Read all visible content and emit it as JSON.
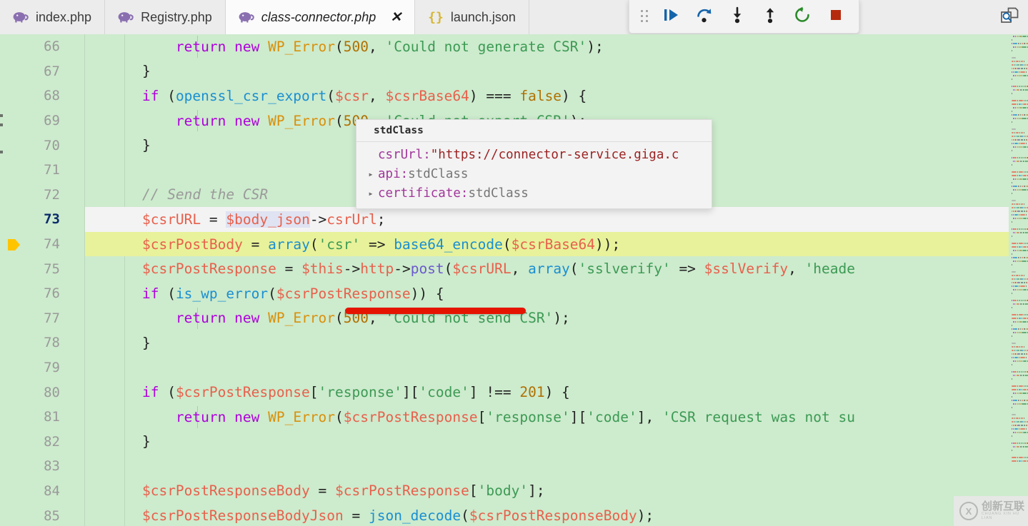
{
  "window": {
    "title": "class-connector.php"
  },
  "tabs": [
    {
      "label": "index.php",
      "icon": "php-elephant-icon",
      "active": false,
      "closable": false
    },
    {
      "label": "Registry.php",
      "icon": "php-elephant-icon",
      "active": false,
      "closable": false
    },
    {
      "label": "class-connector.php",
      "icon": "php-elephant-icon",
      "active": true,
      "closable": true,
      "close_label": "✕"
    },
    {
      "label": "launch.json",
      "icon": "json-braces-icon",
      "icon_text": "{}",
      "active": false,
      "closable": false
    }
  ],
  "debug_toolbar": {
    "handle": "drag-handle-icon",
    "buttons": [
      {
        "name": "continue-button",
        "label": "Continue",
        "icon": "continue-icon",
        "color": "#1464aa"
      },
      {
        "name": "step-over-button",
        "label": "Step Over",
        "icon": "step-over-icon",
        "color": "#1464aa"
      },
      {
        "name": "step-into-button",
        "label": "Step Into",
        "icon": "step-into-icon",
        "color": "#1e1e1e"
      },
      {
        "name": "step-out-button",
        "label": "Step Out",
        "icon": "step-out-icon",
        "color": "#1e1e1e"
      },
      {
        "name": "restart-button",
        "label": "Restart",
        "icon": "restart-icon",
        "color": "#2a8a2a"
      },
      {
        "name": "stop-button",
        "label": "Stop",
        "icon": "stop-icon",
        "color": "#b52a0e"
      }
    ]
  },
  "editor_actions": [
    {
      "name": "open-preview-button",
      "label": "Open Preview to the Side",
      "icon": "preview-search-icon"
    }
  ],
  "editor": {
    "current_line": 73,
    "execution_line": 74,
    "background": "#cdebcd",
    "current_line_highlight": "#f3f3f3",
    "execution_line_highlight": "#e8f29a",
    "lines": [
      {
        "number": 66,
        "tokens": [
          {
            "t": "        ",
            "c": "t-op"
          },
          {
            "t": "return",
            "c": "t-kw"
          },
          {
            "t": " ",
            "c": "t-op"
          },
          {
            "t": "new",
            "c": "t-kw"
          },
          {
            "t": " ",
            "c": "t-op"
          },
          {
            "t": "WP_Error",
            "c": "t-cls"
          },
          {
            "t": "(",
            "c": "t-punct"
          },
          {
            "t": "500",
            "c": "t-num"
          },
          {
            "t": ", ",
            "c": "t-punct"
          },
          {
            "t": "'Could not generate CSR'",
            "c": "t-str"
          },
          {
            "t": ");",
            "c": "t-punct"
          }
        ]
      },
      {
        "number": 67,
        "tokens": [
          {
            "t": "    ",
            "c": "t-op"
          },
          {
            "t": "}",
            "c": "t-punct"
          }
        ]
      },
      {
        "number": 68,
        "tokens": [
          {
            "t": "    ",
            "c": "t-op"
          },
          {
            "t": "if",
            "c": "t-kw"
          },
          {
            "t": " (",
            "c": "t-punct"
          },
          {
            "t": "openssl_csr_export",
            "c": "t-fn"
          },
          {
            "t": "(",
            "c": "t-punct"
          },
          {
            "t": "$csr",
            "c": "t-var"
          },
          {
            "t": ", ",
            "c": "t-punct"
          },
          {
            "t": "$csrBase64",
            "c": "t-var"
          },
          {
            "t": ") ",
            "c": "t-punct"
          },
          {
            "t": "===",
            "c": "t-op"
          },
          {
            "t": " ",
            "c": "t-op"
          },
          {
            "t": "false",
            "c": "t-num"
          },
          {
            "t": ") {",
            "c": "t-punct"
          }
        ]
      },
      {
        "number": 69,
        "tokens": [
          {
            "t": "        ",
            "c": "t-op"
          },
          {
            "t": "return",
            "c": "t-kw"
          },
          {
            "t": " ",
            "c": "t-op"
          },
          {
            "t": "new",
            "c": "t-kw"
          },
          {
            "t": " ",
            "c": "t-op"
          },
          {
            "t": "WP_Error",
            "c": "t-cls"
          },
          {
            "t": "(",
            "c": "t-punct"
          },
          {
            "t": "500",
            "c": "t-num"
          },
          {
            "t": ", ",
            "c": "t-punct"
          },
          {
            "t": "'Could not export CSR'",
            "c": "t-str"
          },
          {
            "t": ");",
            "c": "t-punct"
          }
        ]
      },
      {
        "number": 70,
        "tokens": [
          {
            "t": "    ",
            "c": "t-op"
          },
          {
            "t": "}",
            "c": "t-punct"
          }
        ]
      },
      {
        "number": 71,
        "tokens": []
      },
      {
        "number": 72,
        "tokens": [
          {
            "t": "    ",
            "c": "t-op"
          },
          {
            "t": "// Send the CSR",
            "c": "t-cmt"
          }
        ]
      },
      {
        "number": 73,
        "tokens": [
          {
            "t": "    ",
            "c": "t-op"
          },
          {
            "t": "$csrURL",
            "c": "t-var"
          },
          {
            "t": " ",
            "c": "t-op"
          },
          {
            "t": "=",
            "c": "t-op"
          },
          {
            "t": " ",
            "c": "t-op"
          },
          {
            "t": "$body_json",
            "c": "t-var t-occ"
          },
          {
            "t": "->",
            "c": "t-op"
          },
          {
            "t": "csrUrl",
            "c": "t-prop"
          },
          {
            "t": ";",
            "c": "t-punct"
          }
        ]
      },
      {
        "number": 74,
        "tokens": [
          {
            "t": "    ",
            "c": "t-op"
          },
          {
            "t": "$csrPostBody",
            "c": "t-var"
          },
          {
            "t": " ",
            "c": "t-op"
          },
          {
            "t": "=",
            "c": "t-op"
          },
          {
            "t": " ",
            "c": "t-op"
          },
          {
            "t": "array",
            "c": "t-fn"
          },
          {
            "t": "(",
            "c": "t-punct"
          },
          {
            "t": "'csr'",
            "c": "t-str"
          },
          {
            "t": " ",
            "c": "t-op"
          },
          {
            "t": "=>",
            "c": "t-op"
          },
          {
            "t": " ",
            "c": "t-op"
          },
          {
            "t": "base64_encode",
            "c": "t-fn"
          },
          {
            "t": "(",
            "c": "t-punct"
          },
          {
            "t": "$csrBase64",
            "c": "t-var"
          },
          {
            "t": "));",
            "c": "t-punct"
          }
        ]
      },
      {
        "number": 75,
        "tokens": [
          {
            "t": "    ",
            "c": "t-op"
          },
          {
            "t": "$csrPostResponse",
            "c": "t-var"
          },
          {
            "t": " ",
            "c": "t-op"
          },
          {
            "t": "=",
            "c": "t-op"
          },
          {
            "t": " ",
            "c": "t-op"
          },
          {
            "t": "$this",
            "c": "t-var"
          },
          {
            "t": "->",
            "c": "t-op"
          },
          {
            "t": "http",
            "c": "t-prop"
          },
          {
            "t": "->",
            "c": "t-op"
          },
          {
            "t": "post",
            "c": "t-meth"
          },
          {
            "t": "(",
            "c": "t-punct"
          },
          {
            "t": "$csrURL",
            "c": "t-var"
          },
          {
            "t": ", ",
            "c": "t-punct"
          },
          {
            "t": "array",
            "c": "t-fn"
          },
          {
            "t": "(",
            "c": "t-punct"
          },
          {
            "t": "'sslverify'",
            "c": "t-str"
          },
          {
            "t": " ",
            "c": "t-op"
          },
          {
            "t": "=>",
            "c": "t-op"
          },
          {
            "t": " ",
            "c": "t-op"
          },
          {
            "t": "$sslVerify",
            "c": "t-var"
          },
          {
            "t": ", ",
            "c": "t-punct"
          },
          {
            "t": "'heade",
            "c": "t-str"
          }
        ]
      },
      {
        "number": 76,
        "tokens": [
          {
            "t": "    ",
            "c": "t-op"
          },
          {
            "t": "if",
            "c": "t-kw"
          },
          {
            "t": " (",
            "c": "t-punct"
          },
          {
            "t": "is_wp_error",
            "c": "t-fn"
          },
          {
            "t": "(",
            "c": "t-punct"
          },
          {
            "t": "$csrPostResponse",
            "c": "t-var"
          },
          {
            "t": ")) {",
            "c": "t-punct"
          }
        ]
      },
      {
        "number": 77,
        "tokens": [
          {
            "t": "        ",
            "c": "t-op"
          },
          {
            "t": "return",
            "c": "t-kw"
          },
          {
            "t": " ",
            "c": "t-op"
          },
          {
            "t": "new",
            "c": "t-kw"
          },
          {
            "t": " ",
            "c": "t-op"
          },
          {
            "t": "WP_Error",
            "c": "t-cls"
          },
          {
            "t": "(",
            "c": "t-punct"
          },
          {
            "t": "500",
            "c": "t-num"
          },
          {
            "t": ", ",
            "c": "t-punct"
          },
          {
            "t": "'Could not send CSR'",
            "c": "t-str"
          },
          {
            "t": ");",
            "c": "t-punct"
          }
        ]
      },
      {
        "number": 78,
        "tokens": [
          {
            "t": "    ",
            "c": "t-op"
          },
          {
            "t": "}",
            "c": "t-punct"
          }
        ]
      },
      {
        "number": 79,
        "tokens": []
      },
      {
        "number": 80,
        "tokens": [
          {
            "t": "    ",
            "c": "t-op"
          },
          {
            "t": "if",
            "c": "t-kw"
          },
          {
            "t": " (",
            "c": "t-punct"
          },
          {
            "t": "$csrPostResponse",
            "c": "t-var"
          },
          {
            "t": "[",
            "c": "t-punct"
          },
          {
            "t": "'response'",
            "c": "t-str"
          },
          {
            "t": "][",
            "c": "t-punct"
          },
          {
            "t": "'code'",
            "c": "t-str"
          },
          {
            "t": "] ",
            "c": "t-punct"
          },
          {
            "t": "!==",
            "c": "t-op"
          },
          {
            "t": " ",
            "c": "t-op"
          },
          {
            "t": "201",
            "c": "t-num"
          },
          {
            "t": ") {",
            "c": "t-punct"
          }
        ]
      },
      {
        "number": 81,
        "tokens": [
          {
            "t": "        ",
            "c": "t-op"
          },
          {
            "t": "return",
            "c": "t-kw"
          },
          {
            "t": " ",
            "c": "t-op"
          },
          {
            "t": "new",
            "c": "t-kw"
          },
          {
            "t": " ",
            "c": "t-op"
          },
          {
            "t": "WP_Error",
            "c": "t-cls"
          },
          {
            "t": "(",
            "c": "t-punct"
          },
          {
            "t": "$csrPostResponse",
            "c": "t-var"
          },
          {
            "t": "[",
            "c": "t-punct"
          },
          {
            "t": "'response'",
            "c": "t-str"
          },
          {
            "t": "][",
            "c": "t-punct"
          },
          {
            "t": "'code'",
            "c": "t-str"
          },
          {
            "t": "], ",
            "c": "t-punct"
          },
          {
            "t": "'CSR request was not su",
            "c": "t-str"
          }
        ]
      },
      {
        "number": 82,
        "tokens": [
          {
            "t": "    ",
            "c": "t-op"
          },
          {
            "t": "}",
            "c": "t-punct"
          }
        ]
      },
      {
        "number": 83,
        "tokens": []
      },
      {
        "number": 84,
        "tokens": [
          {
            "t": "    ",
            "c": "t-op"
          },
          {
            "t": "$csrPostResponseBody",
            "c": "t-var"
          },
          {
            "t": " ",
            "c": "t-op"
          },
          {
            "t": "=",
            "c": "t-op"
          },
          {
            "t": " ",
            "c": "t-op"
          },
          {
            "t": "$csrPostResponse",
            "c": "t-var"
          },
          {
            "t": "[",
            "c": "t-punct"
          },
          {
            "t": "'body'",
            "c": "t-str"
          },
          {
            "t": "];",
            "c": "t-punct"
          }
        ]
      },
      {
        "number": 85,
        "tokens": [
          {
            "t": "    ",
            "c": "t-op"
          },
          {
            "t": "$csrPostResponseBodyJson",
            "c": "t-var"
          },
          {
            "t": " ",
            "c": "t-op"
          },
          {
            "t": "=",
            "c": "t-op"
          },
          {
            "t": " ",
            "c": "t-op"
          },
          {
            "t": "json_decode",
            "c": "t-fn"
          },
          {
            "t": "(",
            "c": "t-punct"
          },
          {
            "t": "$csrPostResponseBody",
            "c": "t-var"
          },
          {
            "t": ");",
            "c": "t-punct"
          }
        ]
      }
    ]
  },
  "hover_popup": {
    "title": "stdClass",
    "rows": [
      {
        "expandable": false,
        "key": "csrUrl",
        "sep": ": ",
        "value": "\"https://connector-service.giga.c",
        "value_type": "string"
      },
      {
        "expandable": true,
        "key": "api",
        "sep": ": ",
        "value": "stdClass",
        "value_type": "object"
      },
      {
        "expandable": true,
        "key": "certificate",
        "sep": ": ",
        "value": "stdClass",
        "value_type": "object"
      }
    ],
    "twisty_glyph": "▸"
  },
  "annotation": {
    "name": "red-underline-highlight",
    "target_text": "$this->http->post(",
    "color": "#e51400"
  },
  "watermark": {
    "cn": "创新互联",
    "en": "CHUANG XIN HU LIAN",
    "mark": "X"
  }
}
